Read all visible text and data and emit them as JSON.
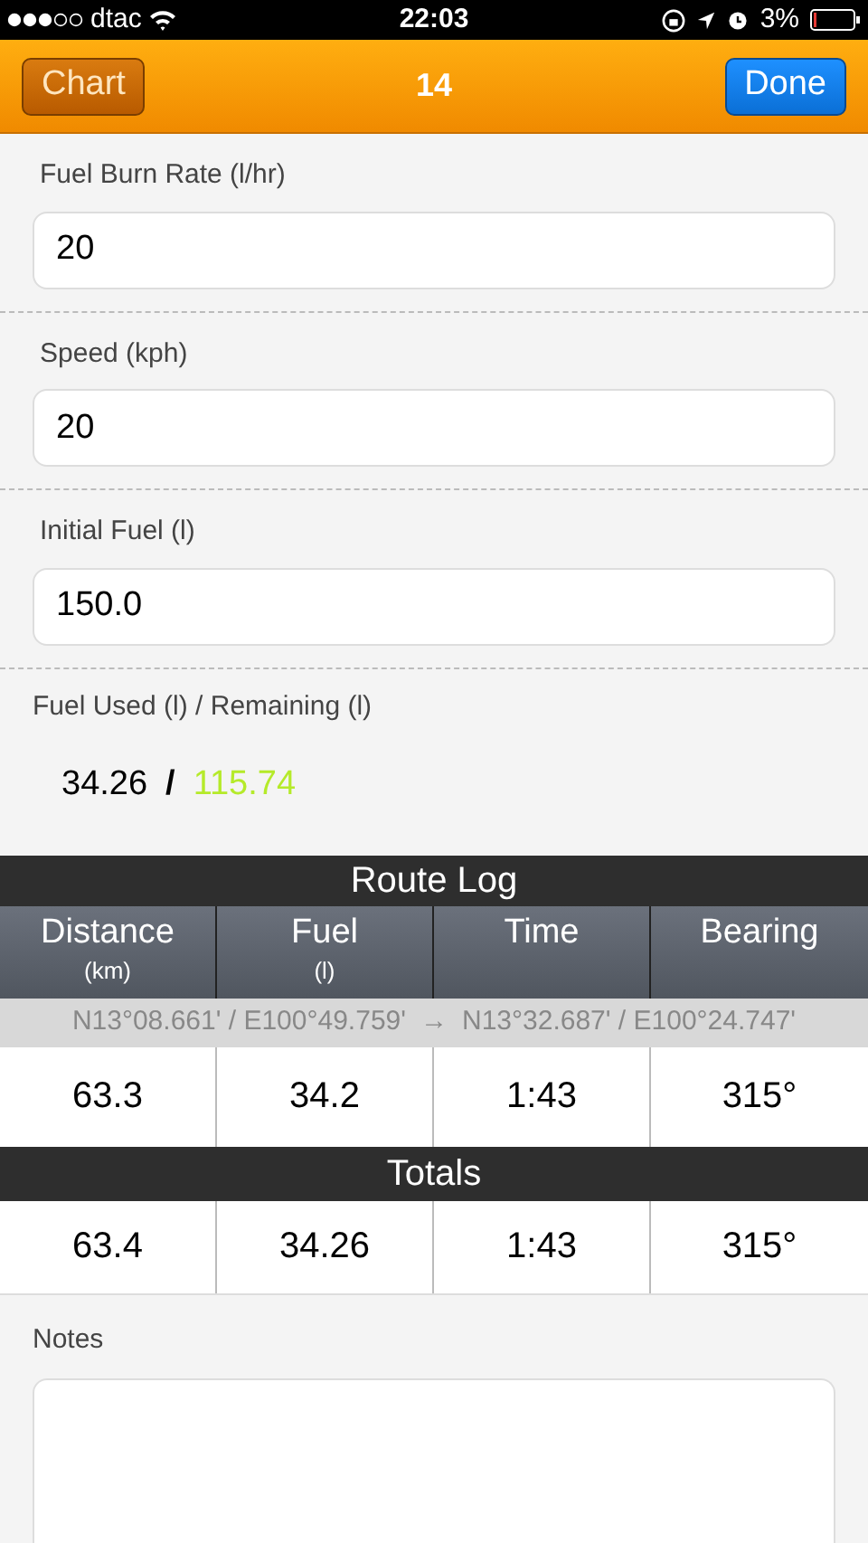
{
  "status_bar": {
    "carrier": "dtac",
    "time": "22:03",
    "battery": "3%"
  },
  "nav_bar": {
    "left_button": "Chart",
    "title": "14",
    "right_button": "Done"
  },
  "fields": [
    {
      "label": "Fuel Burn Rate (l/hr)",
      "value": "20"
    },
    {
      "label": "Speed (kph)",
      "value": "20"
    },
    {
      "label": "Initial Fuel (l)",
      "value": "150.0"
    }
  ],
  "fuel_summary": {
    "label": "Fuel Used (l) / Remaining (l)",
    "used": "34.26",
    "separator": "/",
    "remaining": "115.74"
  },
  "route_log": {
    "title": "Route Log",
    "columns": [
      {
        "name": "Distance",
        "unit": "(km)"
      },
      {
        "name": "Fuel",
        "unit": "(l)"
      },
      {
        "name": "Time"
      },
      {
        "name": "Bearing"
      }
    ],
    "legs": [
      {
        "from": "N13°08.661' / E100°49.759'",
        "arrow": "→",
        "to": "N13°32.687' / E100°24.747'",
        "cells": [
          "63.3",
          "34.2",
          "1:43",
          "315°"
        ]
      }
    ]
  },
  "totals": {
    "title": "Totals",
    "cells": [
      "63.4",
      "34.26",
      "1:43",
      "315°"
    ]
  },
  "notes": {
    "label": "Notes"
  }
}
